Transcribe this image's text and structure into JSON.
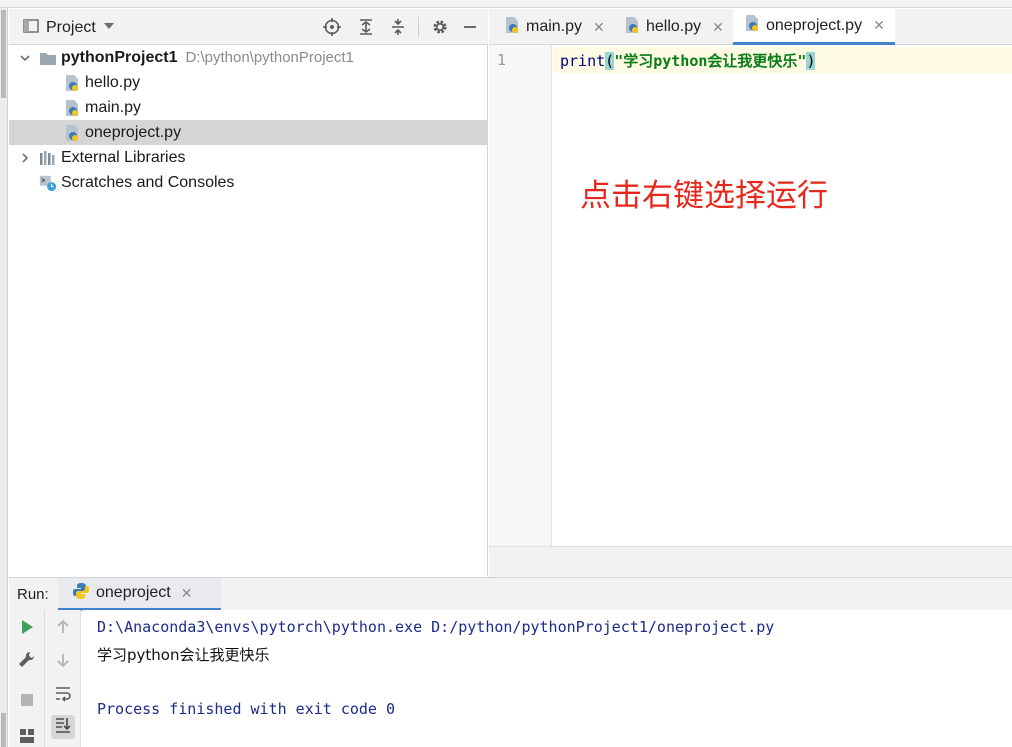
{
  "project_panel": {
    "title": "Project",
    "tree": [
      {
        "label": "pythonProject1",
        "path": "D:\\python\\pythonProject1"
      },
      {
        "label": "hello.py"
      },
      {
        "label": "main.py"
      },
      {
        "label": "oneproject.py"
      },
      {
        "label": "External Libraries"
      },
      {
        "label": "Scratches and Consoles"
      }
    ]
  },
  "editor": {
    "tabs": [
      {
        "label": "main.py"
      },
      {
        "label": "hello.py"
      },
      {
        "label": "oneproject.py",
        "active": true
      }
    ],
    "line_number": "1",
    "code": {
      "func": "print",
      "open": "(",
      "string": "\"学习python会让我更快乐\"",
      "close": ")"
    },
    "annotation": "点击右键选择运行"
  },
  "run_panel": {
    "label": "Run:",
    "tab_label": "oneproject",
    "console": [
      "D:\\Anaconda3\\envs\\pytorch\\python.exe D:/python/pythonProject1/oneproject.py",
      "学习python会让我更快乐",
      "Process finished with exit code 0"
    ]
  },
  "colors": {
    "accent": "#4083c9",
    "annotation": "#e8271c",
    "console_text": "#1d2b8a",
    "string": "#067d17",
    "selection": "#d5d5d5"
  }
}
